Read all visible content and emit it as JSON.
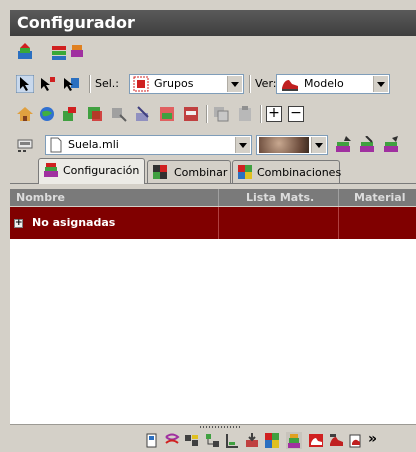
{
  "window": {
    "title": "Configurador"
  },
  "toolbar_top": {
    "icons": [
      "layers-up-icon",
      "layers-stack-icon"
    ]
  },
  "selection_bar": {
    "icons": [
      "select-arrow-icon",
      "select-node-icon",
      "select-multi-icon"
    ],
    "sel_label": "Sel.:",
    "sel_value": "Grupos",
    "sel_icon": "groups-icon",
    "ver_label": "Ver:",
    "ver_value": "Modelo",
    "ver_icon": "shoe-model-icon"
  },
  "edit_toolbar": {
    "icons": [
      "home-icon",
      "globe-icon",
      "paint-icon",
      "assign-icon",
      "unassign-icon",
      "magic-icon",
      "material-a-icon",
      "material-b-icon",
      "copy-icon",
      "paste-icon"
    ],
    "add_label": "+",
    "remove_label": "−"
  },
  "file_bar": {
    "file_icon": "keyboard-icon",
    "file_value": "Suela.mli",
    "swatch_name": "material-swatch",
    "action_icons": [
      "stack-export-icon",
      "stack-import-icon",
      "stack-apply-icon"
    ]
  },
  "tabs": [
    {
      "label": "Configuración",
      "icon": "config-icon",
      "active": true
    },
    {
      "label": "Combinar",
      "icon": "combine-icon",
      "active": false
    },
    {
      "label": "Combinaciones",
      "icon": "combinations-icon",
      "active": false
    }
  ],
  "table": {
    "columns": [
      "Nombre",
      "Lista Mats.",
      "Material"
    ],
    "rows": [
      {
        "expander": "+",
        "name": "No asignadas",
        "list": "",
        "material": ""
      }
    ]
  },
  "bottom_toolbar": {
    "icons": [
      "door-icon",
      "link-icon",
      "merge-icon",
      "tree-icon",
      "ruler-icon",
      "import-icon",
      "color-grid-icon",
      "stack-icon",
      "red-shoe-icon",
      "shoe-layers-icon",
      "shoe-print-icon",
      "more-icon"
    ]
  },
  "colors": {
    "title_bg": "#4a4a4a",
    "row_selected": "#800000",
    "header_bg": "#7a7a7a"
  }
}
